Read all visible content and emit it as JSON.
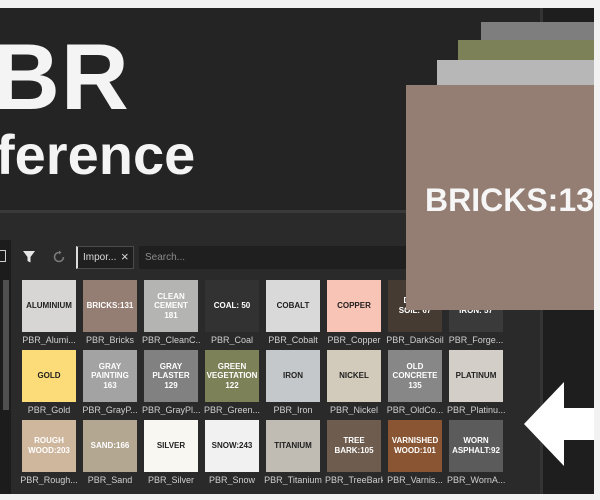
{
  "title": {
    "line1": "BR",
    "line2": "ference"
  },
  "toolbar": {
    "tag_label": "Impor...",
    "tag_close": "×",
    "search_placeholder": "Search..."
  },
  "featured": {
    "label": "BRICKS:13",
    "color": "#947d73"
  },
  "materials": [
    {
      "label": "ALUMINIUM",
      "caption": "PBR_Alumi...",
      "color": "#d7d6d4",
      "text_color": "#1f1f1f"
    },
    {
      "label": "BRICKS:131",
      "caption": "PBR_Bricks",
      "color": "#947d73",
      "text_color": "#ffffff"
    },
    {
      "label": "CLEAN\nCEMENT\n181",
      "caption": "PBR_CleanC...",
      "color": "#b4b4b2",
      "text_color": "#ffffff"
    },
    {
      "label": "COAL: 50",
      "caption": "PBR_Coal",
      "color": "#323232",
      "text_color": "#ffffff"
    },
    {
      "label": "COBALT",
      "caption": "PBR_Cobalt",
      "color": "#d9d9d9",
      "text_color": "#1f1f1f"
    },
    {
      "label": "COPPER",
      "caption": "PBR_Copper",
      "color": "#f8c4b6",
      "text_color": "#1f1f1f"
    },
    {
      "label": "DARK\nSOIL: 67",
      "caption": "PBR_DarkSoil",
      "color": "#463b33",
      "text_color": "#ffffff"
    },
    {
      "label": "FORGED\nIRON: 57",
      "caption": "PBR_Forge...",
      "color": "#3a3a3a",
      "text_color": "#ffffff"
    },
    {
      "label": "GOLD",
      "caption": "PBR_Gold",
      "color": "#fbdc79",
      "text_color": "#1f1f1f"
    },
    {
      "label": "GRAY\nPAINTING\n163",
      "caption": "PBR_GrayP...",
      "color": "#a3a3a3",
      "text_color": "#ffffff"
    },
    {
      "label": "GRAY\nPLASTER\n129",
      "caption": "PBR_GrayPl...",
      "color": "#818181",
      "text_color": "#ffffff"
    },
    {
      "label": "GREEN\nVEGETATION\n122",
      "caption": "PBR_Green...",
      "color": "#7c8157",
      "text_color": "#ffffff"
    },
    {
      "label": "IRON",
      "caption": "PBR_Iron",
      "color": "#c5c8ca",
      "text_color": "#1f1f1f"
    },
    {
      "label": "NICKEL",
      "caption": "PBR_Nickel",
      "color": "#d2cbbb",
      "text_color": "#1f1f1f"
    },
    {
      "label": "OLD\nCONCRETE\n135",
      "caption": "PBR_OldCo...",
      "color": "#878787",
      "text_color": "#ffffff"
    },
    {
      "label": "PLATINUM",
      "caption": "PBR_Platinu...",
      "color": "#d3cfc8",
      "text_color": "#1f1f1f"
    },
    {
      "label": "ROUGH\nWOOD:203",
      "caption": "PBR_Rough...",
      "color": "#cfb79d",
      "text_color": "#ffffff"
    },
    {
      "label": "SAND:166",
      "caption": "PBR_Sand",
      "color": "#b3a792",
      "text_color": "#ffffff"
    },
    {
      "label": "SILVER",
      "caption": "PBR_Silver",
      "color": "#f9f7f2",
      "text_color": "#1f1f1f"
    },
    {
      "label": "SNOW:243",
      "caption": "PBR_Snow",
      "color": "#f1f1f1",
      "text_color": "#1f1f1f"
    },
    {
      "label": "TITANIUM",
      "caption": "PBR_Titanium",
      "color": "#c1bcb3",
      "text_color": "#1f1f1f"
    },
    {
      "label": "TREE\nBARK:105",
      "caption": "PBR_TreeBark",
      "color": "#6e5d4e",
      "text_color": "#ffffff"
    },
    {
      "label": "VARNISHED\nWOOD:101",
      "caption": "PBR_Varnis...",
      "color": "#8a5533",
      "text_color": "#ffffff"
    },
    {
      "label": "WORN\nASPHALT:92",
      "caption": "PBR_WornA...",
      "color": "#5b5b5b",
      "text_color": "#ffffff"
    }
  ],
  "icons": {
    "filter": "filter-icon",
    "refresh": "refresh-icon",
    "arrow": "arrow-left-icon"
  }
}
